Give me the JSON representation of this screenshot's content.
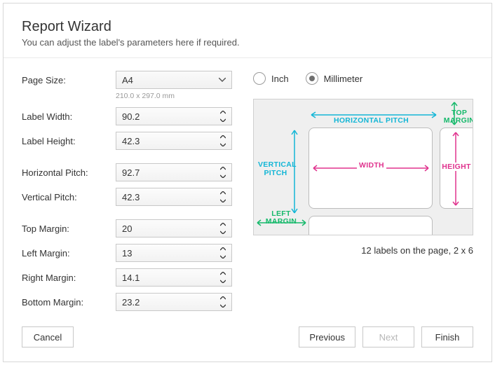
{
  "header": {
    "title": "Report Wizard",
    "subtitle": "You can adjust the label's parameters here if required."
  },
  "page_size": {
    "label": "Page Size:",
    "value": "A4",
    "hint": "210.0 x 297.0 mm"
  },
  "fields": {
    "label_width": {
      "label": "Label Width:",
      "value": "90.2"
    },
    "label_height": {
      "label": "Label Height:",
      "value": "42.3"
    },
    "h_pitch": {
      "label": "Horizontal Pitch:",
      "value": "92.7"
    },
    "v_pitch": {
      "label": "Vertical Pitch:",
      "value": "42.3"
    },
    "top_margin": {
      "label": "Top Margin:",
      "value": "20"
    },
    "left_margin": {
      "label": "Left Margin:",
      "value": "13"
    },
    "right_margin": {
      "label": "Right Margin:",
      "value": "14.1"
    },
    "bottom_margin": {
      "label": "Bottom Margin:",
      "value": "23.2"
    }
  },
  "units": {
    "inch": "Inch",
    "mm": "Millimeter",
    "selected": "mm"
  },
  "preview": {
    "h_pitch": "HORIZONTAL PITCH",
    "v_pitch": "VERTICAL PITCH",
    "top_margin": "TOP MARGIN",
    "left_margin": "LEFT MARGIN",
    "width": "WIDTH",
    "height": "HEIGHT",
    "summary": "12 labels on the page, 2 x 6"
  },
  "footer": {
    "cancel": "Cancel",
    "previous": "Previous",
    "next": "Next",
    "finish": "Finish"
  }
}
